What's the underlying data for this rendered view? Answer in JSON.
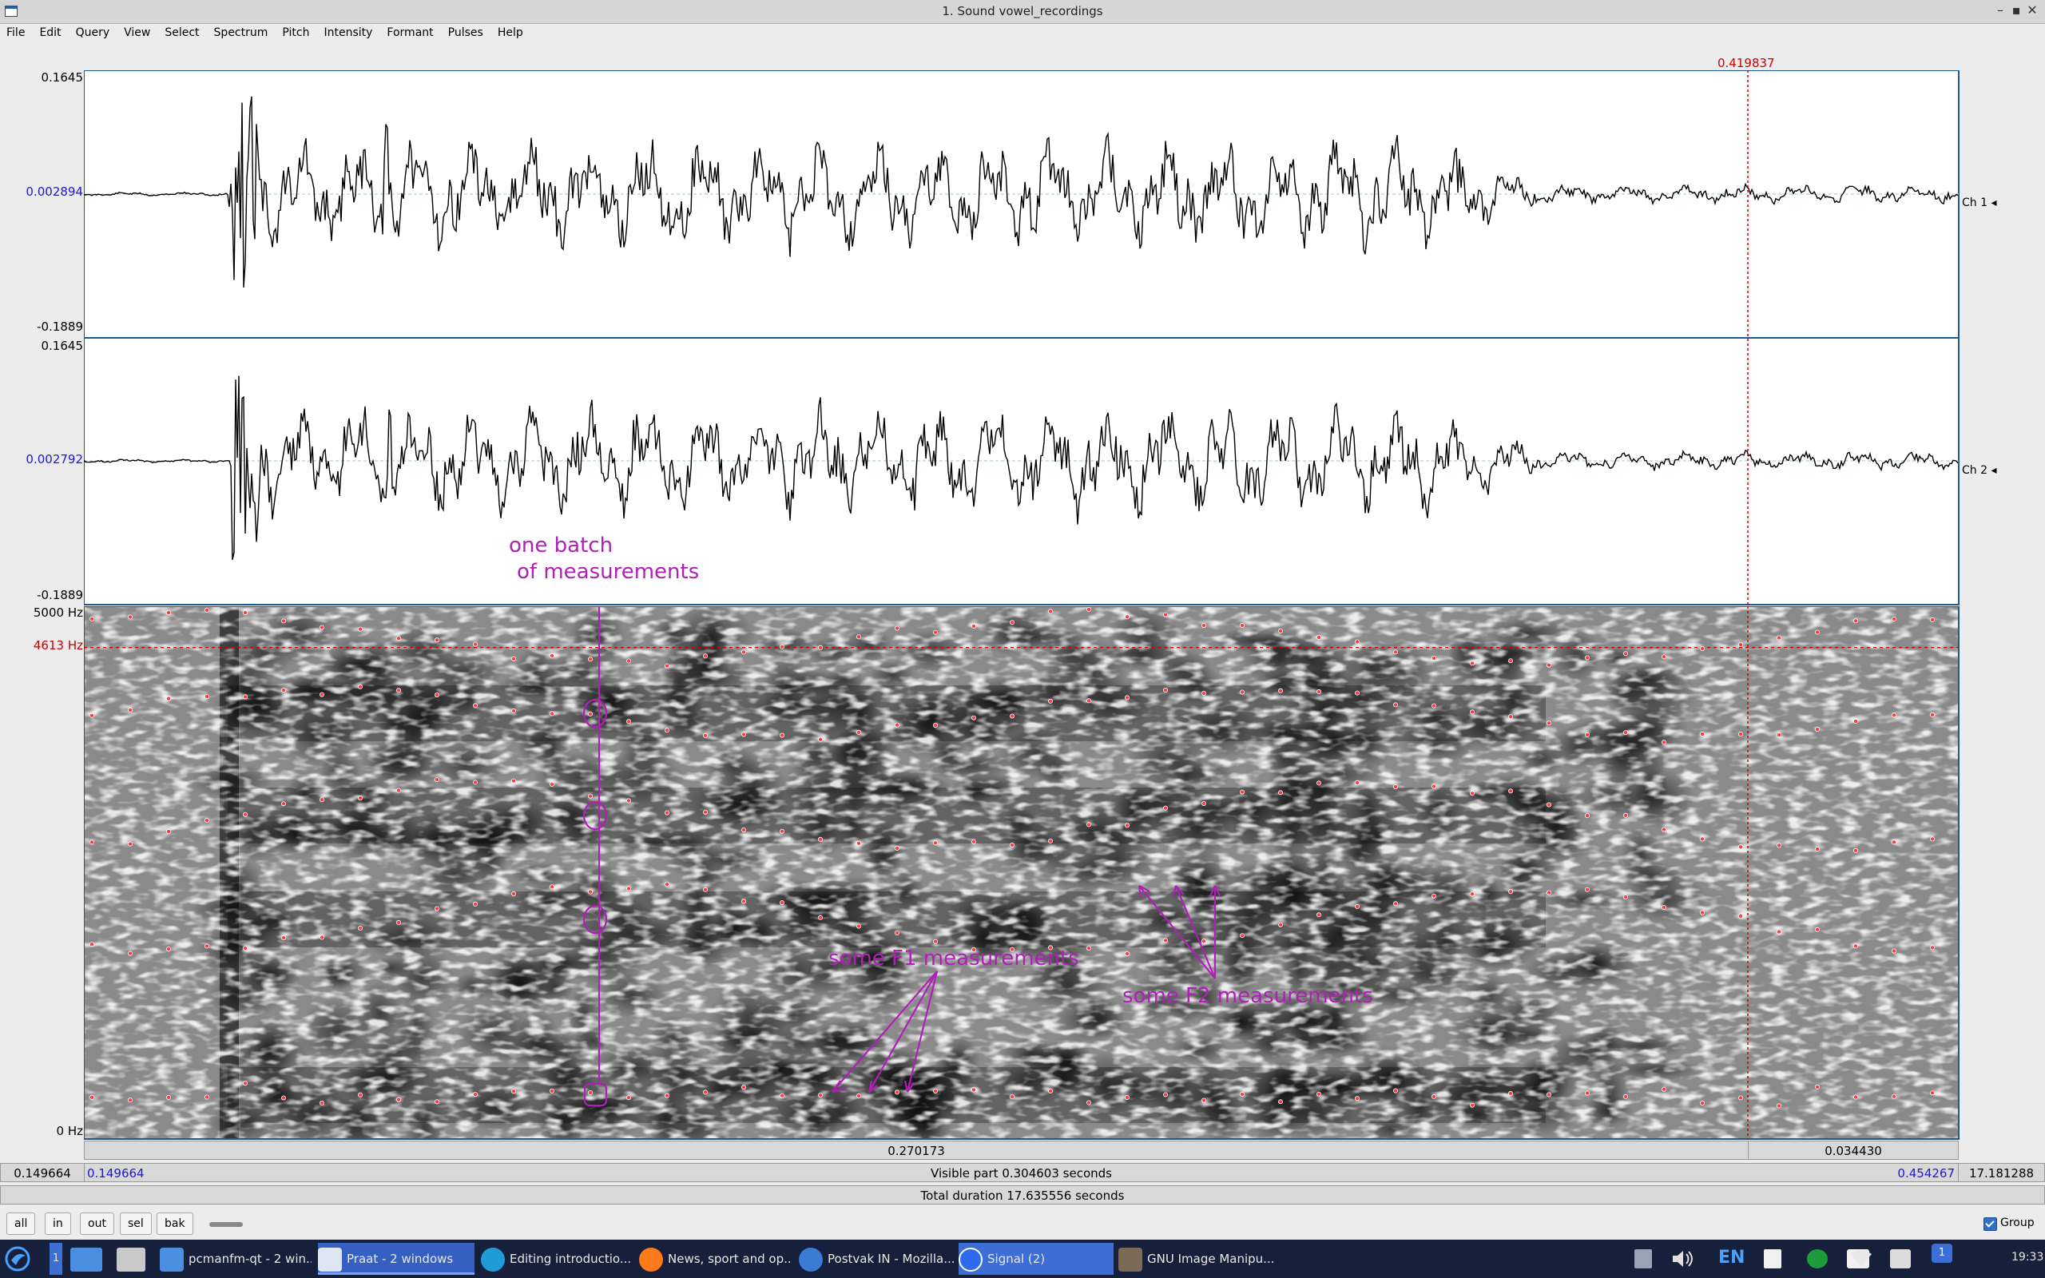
{
  "window": {
    "title": "1. Sound vowel_recordings"
  },
  "menu": [
    "File",
    "Edit",
    "Query",
    "View",
    "Select",
    "Spectrum",
    "Pitch",
    "Intensity",
    "Formant",
    "Pulses",
    "Help"
  ],
  "cursor_time": "0.419837",
  "channels": [
    {
      "label": "Ch 1",
      "max": "0.1645",
      "mid": "0.002894",
      "min": "-0.1889"
    },
    {
      "label": "Ch 2",
      "max": "0.1645",
      "mid": "0.002792",
      "min": "-0.1889"
    }
  ],
  "spectrogram": {
    "top_label": "5000 Hz",
    "cursor_label": "4613 Hz",
    "bottom_label": "0 Hz",
    "cursor_hz": 4613,
    "max_hz": 5000
  },
  "annotations": {
    "batch": [
      "one batch",
      "of measurements"
    ],
    "f1": "some F1 measurements",
    "f2": "some F2 measurements"
  },
  "time_bar_1": {
    "left_segment": "0.270173",
    "right_segment": "0.034430"
  },
  "time_bar_2": {
    "outer_left": "0.149664",
    "left": "0.149664",
    "center": "Visible part 0.304603 seconds",
    "right": "0.454267",
    "outer_right": "17.181288"
  },
  "time_bar_3": {
    "total": "Total duration 17.635556 seconds"
  },
  "view_buttons": [
    "all",
    "in",
    "out",
    "sel",
    "bak"
  ],
  "group": {
    "label": "Group",
    "checked": true
  },
  "taskbar": {
    "workspace": "1",
    "items": [
      {
        "label": "pcmanfm-qt - 2 win..."
      },
      {
        "label": "Praat - 2 windows"
      },
      {
        "label": "Editing introductio..."
      },
      {
        "label": "News, sport and op..."
      },
      {
        "label": "Postvak IN - Mozilla..."
      },
      {
        "label": "Signal (2)"
      },
      {
        "label": "GNU Image Manipu..."
      }
    ],
    "lang": "EN",
    "badge": "1",
    "clock": "19:33"
  },
  "colors": {
    "accent_red": "#cc0000",
    "annotation": "#b020b8",
    "axis_blue": "#1a1ad0",
    "taskbar_bg": "#16203a"
  }
}
